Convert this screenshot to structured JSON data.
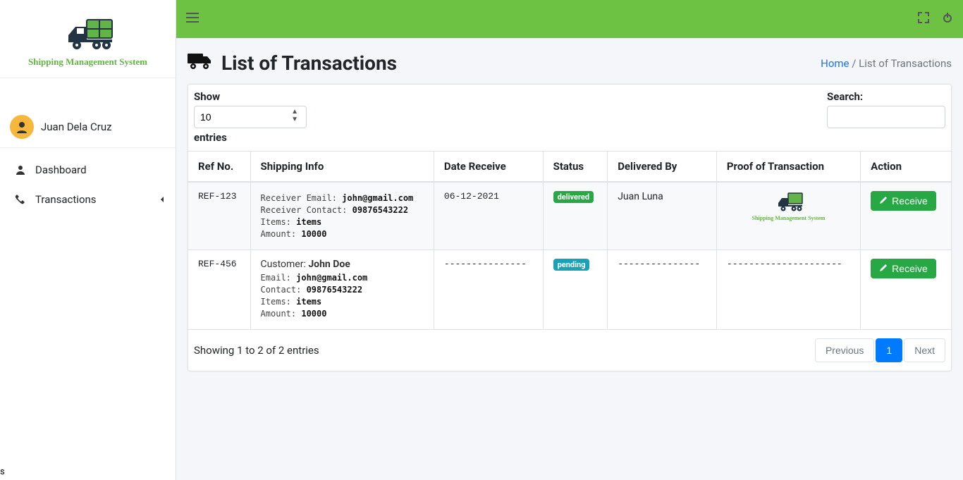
{
  "brand": {
    "name": "Shipping Management System"
  },
  "user": {
    "name": "Juan Dela Cruz"
  },
  "nav": {
    "dashboard": "Dashboard",
    "transactions": "Transactions"
  },
  "breadcrumb": {
    "home": "Home",
    "current": "List of Transactions"
  },
  "page": {
    "title": "List of Transactions"
  },
  "datatable": {
    "show_label": "Show",
    "entries_label": "entries",
    "length_value": "10",
    "search_label": "Search:",
    "search_value": "",
    "columns": {
      "ref": "Ref No.",
      "shipping": "Shipping Info",
      "date": "Date Receive",
      "status": "Status",
      "delivered_by": "Delivered By",
      "proof": "Proof of Transaction",
      "action": "Action"
    },
    "info": "Showing 1 to 2 of 2 entries",
    "prev": "Previous",
    "next": "Next",
    "page1": "1"
  },
  "rows": [
    {
      "ref": "REF-123",
      "shipping": {
        "receiver_email_label": "Receiver Email: ",
        "receiver_email": "john@gmail.com",
        "receiver_contact_label": "Receiver Contact: ",
        "receiver_contact": "09876543222",
        "items_label": "Items: ",
        "items": "items",
        "amount_label": "Amount: ",
        "amount": "10000"
      },
      "date": "06-12-2021",
      "status": "delivered",
      "status_class": "badge-success",
      "delivered_by": "Juan Luna",
      "proof": "thumb",
      "action_label": "Receive"
    },
    {
      "ref": "REF-456",
      "shipping": {
        "customer_label": "Customer: ",
        "customer": "John Doe",
        "email_label": "Email: ",
        "email": "john@gmail.com",
        "contact_label": "Contact: ",
        "contact": "09876543222",
        "items_label": "Items: ",
        "items": "items",
        "amount_label": "Amount: ",
        "amount": "10000"
      },
      "date": "---------------",
      "status": "pending",
      "status_class": "badge-info",
      "delivered_by": "---------------",
      "proof": "---------------------",
      "action_label": "Receive"
    }
  ],
  "stray_char": "s"
}
